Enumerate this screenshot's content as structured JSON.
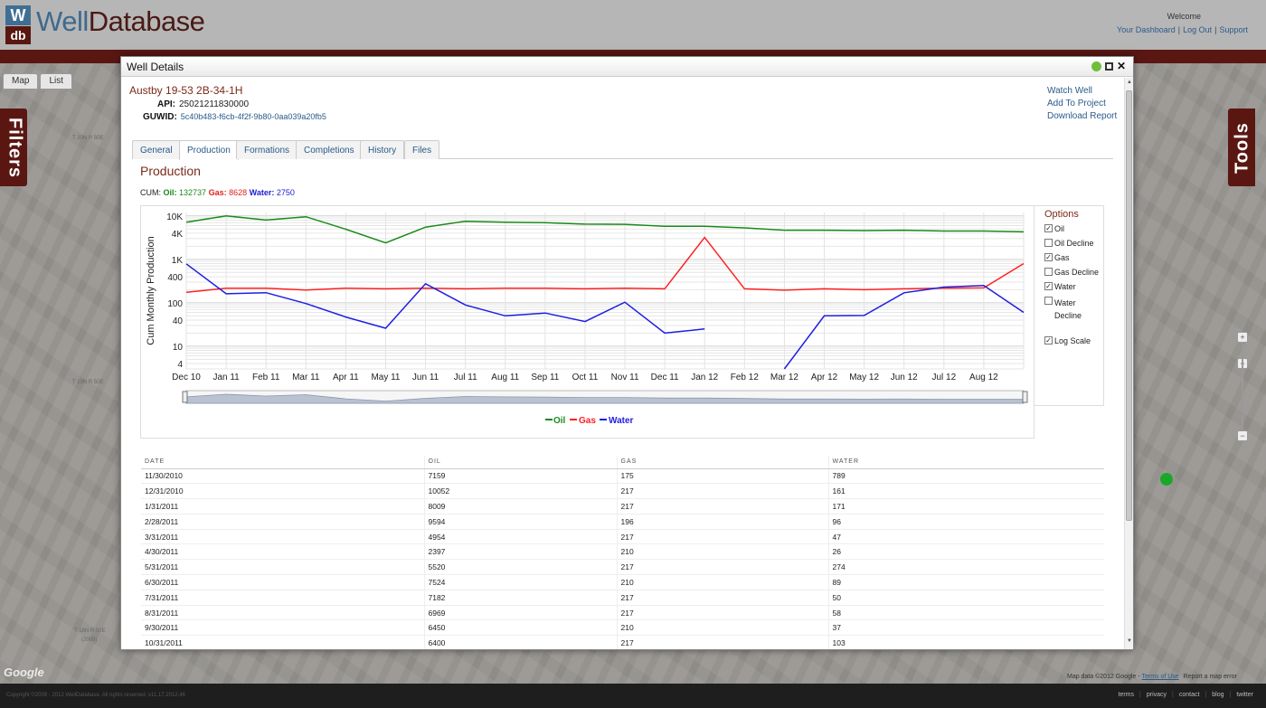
{
  "app": {
    "brand_well": "Well",
    "brand_database": "Database",
    "logo_w": "W",
    "logo_db": "db",
    "welcome": "Welcome",
    "links": [
      "Your Dashboard",
      "Log Out",
      "Support"
    ]
  },
  "map": {
    "tabs": [
      "Map",
      "List"
    ],
    "filters_label": "Filters",
    "tools_label": "Tools",
    "labels": [
      "T 20N R 50E",
      "T 19N R 50E",
      "T 18N R 50E",
      "(2009)"
    ],
    "google": "Google",
    "credits_text": "Map data ©2012 Google -",
    "terms": "Terms of Use",
    "report_error": "Report a map error",
    "zoom_in": "+",
    "zoom_out": "−"
  },
  "footer": {
    "copyright": "Copyright ©2009 - 2012 WellDatabase. All rights reserved. v11.17.2012.46",
    "links": [
      "terms",
      "privacy",
      "contact",
      "blog",
      "twitter"
    ]
  },
  "dialog": {
    "title": "Well Details",
    "well_name": "Austby 19-53 2B-34-1H",
    "api_label": "API:",
    "api_value": "25021211830000",
    "guwid_label": "GUWID:",
    "guwid_value": "5c40b483-f6cb-4f2f-9b80-0aa039a20fb5",
    "actions": [
      "Watch Well",
      "Add To Project",
      "Download Report"
    ],
    "tabs": [
      "General",
      "Production",
      "Formations",
      "Completions",
      "History",
      "Files"
    ],
    "active_tab": "Production",
    "section_title": "Production",
    "cum": {
      "prefix": "CUM:",
      "oil_label": "Oil:",
      "oil": "132737",
      "gas_label": "Gas:",
      "gas": "8628",
      "water_label": "Water:",
      "water": "2750"
    },
    "options": {
      "title": "Options",
      "items": [
        {
          "label": "Oil",
          "checked": true
        },
        {
          "label": "Oil Decline",
          "checked": false
        },
        {
          "label": "Gas",
          "checked": true
        },
        {
          "label": "Gas Decline",
          "checked": false
        },
        {
          "label": "Water",
          "checked": true
        },
        {
          "label": "Water Decline",
          "checked": false
        },
        {
          "label": "Log Scale",
          "checked": true
        }
      ]
    },
    "table": {
      "headers": [
        "DATE",
        "OIL",
        "GAS",
        "WATER"
      ],
      "rows": [
        [
          "11/30/2010",
          "7159",
          "175",
          "789"
        ],
        [
          "12/31/2010",
          "10052",
          "217",
          "161"
        ],
        [
          "1/31/2011",
          "8009",
          "217",
          "171"
        ],
        [
          "2/28/2011",
          "9594",
          "196",
          "96"
        ],
        [
          "3/31/2011",
          "4954",
          "217",
          "47"
        ],
        [
          "4/30/2011",
          "2397",
          "210",
          "26"
        ],
        [
          "5/31/2011",
          "5520",
          "217",
          "274"
        ],
        [
          "6/30/2011",
          "7524",
          "210",
          "89"
        ],
        [
          "7/31/2011",
          "7182",
          "217",
          "50"
        ],
        [
          "8/31/2011",
          "6969",
          "217",
          "58"
        ],
        [
          "9/30/2011",
          "6450",
          "210",
          "37"
        ],
        [
          "10/31/2011",
          "6400",
          "217",
          "103"
        ]
      ]
    }
  },
  "colors": {
    "oil": "#1a8a1a",
    "gas": "#ff2020",
    "water": "#1e1ee0",
    "brand_red": "#5a1712",
    "brand_blue": "#3e6a8c",
    "link": "#2b5a8a"
  },
  "chart_data": {
    "type": "line",
    "log_scale": true,
    "ylabel": "Cum Monthly Production",
    "ylim": [
      3,
      12000
    ],
    "y_ticks": [
      4,
      10,
      40,
      100,
      400,
      "1K",
      "4K",
      "10K"
    ],
    "y_tick_values": [
      4,
      10,
      40,
      100,
      400,
      1000,
      4000,
      10000
    ],
    "x_tick_labels": [
      "Dec 10",
      "Jan 11",
      "Feb 11",
      "Mar 11",
      "Apr 11",
      "May 11",
      "Jun 11",
      "Jul 11",
      "Aug 11",
      "Sep 11",
      "Oct 11",
      "Nov 11",
      "Dec 11",
      "Jan 12",
      "Feb 12",
      "Mar 12",
      "Apr 12",
      "May 12",
      "Jun 12",
      "Jul 12",
      "Aug 12"
    ],
    "legend": "bottom-center",
    "series": [
      {
        "name": "Oil",
        "values": [
          7159,
          10052,
          8009,
          9594,
          4954,
          2397,
          5520,
          7524,
          7182,
          6969,
          6450,
          6400,
          5800,
          5800,
          5300,
          4700,
          4700,
          4600,
          4700,
          4500,
          4500,
          4300
        ]
      },
      {
        "name": "Gas",
        "values": [
          175,
          217,
          217,
          196,
          217,
          210,
          217,
          210,
          217,
          217,
          210,
          217,
          210,
          3200,
          210,
          195,
          210,
          200,
          210,
          217,
          220,
          800
        ]
      },
      {
        "name": "Water",
        "values": [
          789,
          161,
          171,
          96,
          47,
          26,
          274,
          89,
          50,
          58,
          37,
          103,
          20,
          25,
          null,
          3,
          50,
          51,
          170,
          230,
          250,
          60
        ]
      }
    ]
  }
}
